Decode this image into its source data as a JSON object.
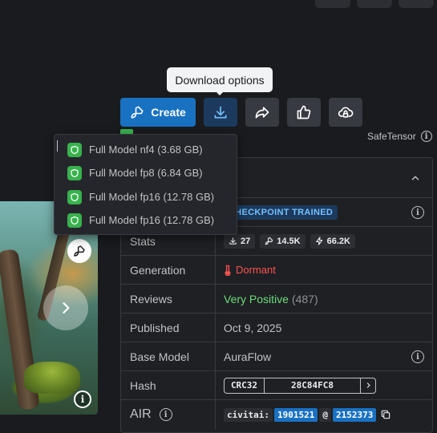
{
  "tooltip": {
    "text": "Download options"
  },
  "actions": {
    "create_label": "Create",
    "download_icon": "download-icon",
    "share_icon": "share-icon",
    "like_icon": "thumbs-up-icon",
    "cloud_icon": "cloud-lock-icon",
    "accent": "#1971c2"
  },
  "file_format": {
    "label": "SafeTensor"
  },
  "download_menu": {
    "items": [
      {
        "label": "Full Model nf4 (3.68 GB)"
      },
      {
        "label": "Full Model fp8 (6.84 GB)"
      },
      {
        "label": "Full Model fp16 (12.78 GB)"
      },
      {
        "label": "Full Model fp16 (12.78 GB)"
      }
    ]
  },
  "details": {
    "type": {
      "value": "CHECKPOINT TRAINED"
    },
    "stats": {
      "label": "Stats",
      "downloads": "27",
      "likes": "14.5K",
      "buzz": "66.2K"
    },
    "generation": {
      "label": "Generation",
      "value": "Dormant",
      "color": "#fa5252"
    },
    "reviews": {
      "label": "Reviews",
      "value": "Very Positive",
      "count": "(487)",
      "color": "#69db7c"
    },
    "published": {
      "label": "Published",
      "value": "Oct 9, 2025"
    },
    "base_model": {
      "label": "Base Model",
      "value": "AuraFlow"
    },
    "hash": {
      "label": "Hash",
      "algo": "CRC32",
      "value": "28C84FC8"
    },
    "air": {
      "label": "AIR",
      "prefix": "civitai:",
      "model_id": "1901521",
      "sep": "@",
      "version_id": "2152373"
    }
  }
}
